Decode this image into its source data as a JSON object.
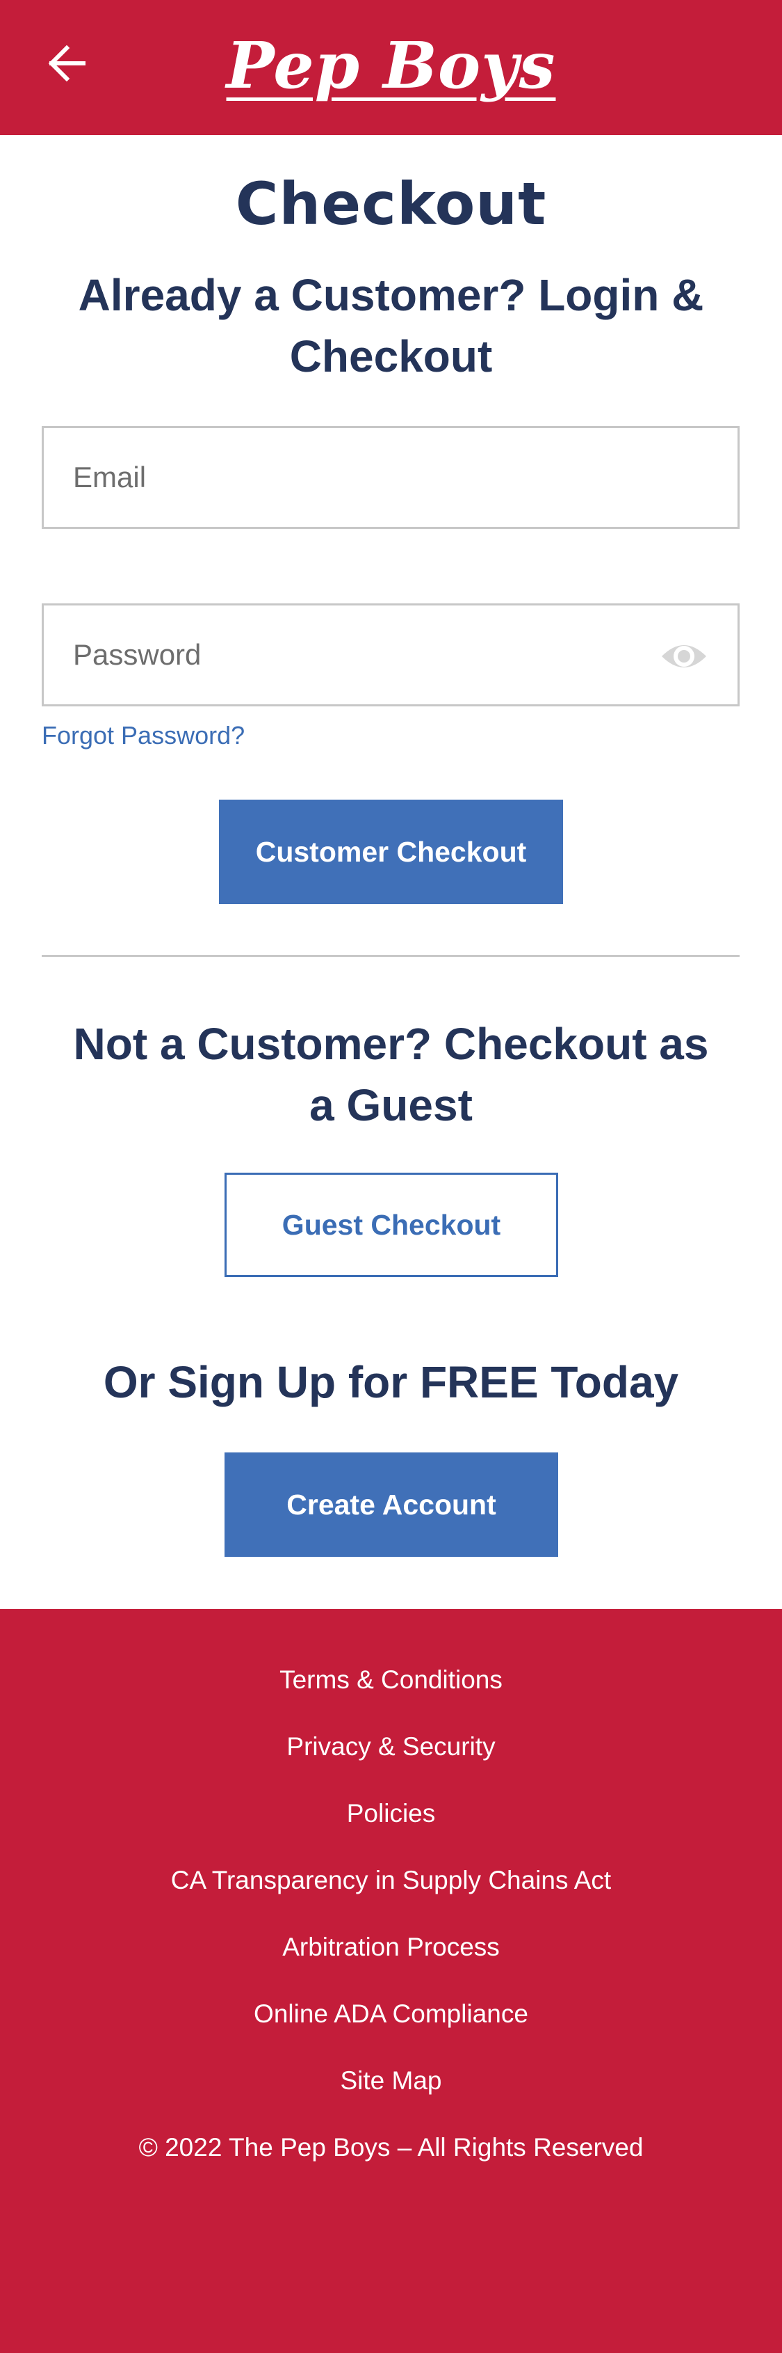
{
  "header": {
    "brand": "Pep Boys",
    "back_icon": "arrow-left-icon",
    "color": "#c41d3a"
  },
  "page": {
    "title": "Checkout"
  },
  "login": {
    "heading": "Already a Customer? Login & Checkout",
    "email_placeholder": "Email",
    "password_placeholder": "Password",
    "show_password_icon": "eye-icon",
    "forgot_password": "Forgot Password?",
    "submit_label": "Customer Checkout"
  },
  "guest": {
    "heading": "Not a Customer? Checkout as a Guest",
    "button_label": "Guest Checkout"
  },
  "signup": {
    "heading": "Or Sign Up for FREE Today",
    "button_label": "Create Account"
  },
  "footer": {
    "links": [
      "Terms & Conditions",
      "Privacy & Security",
      "Policies",
      "CA Transparency in Supply Chains Act",
      "Arbitration Process",
      "Online ADA Compliance",
      "Site Map"
    ],
    "copyright": "© 2022 The Pep Boys – All Rights Reserved"
  },
  "colors": {
    "brand_red": "#c41d3a",
    "navy": "#243459",
    "accent_blue": "#4070b8"
  }
}
